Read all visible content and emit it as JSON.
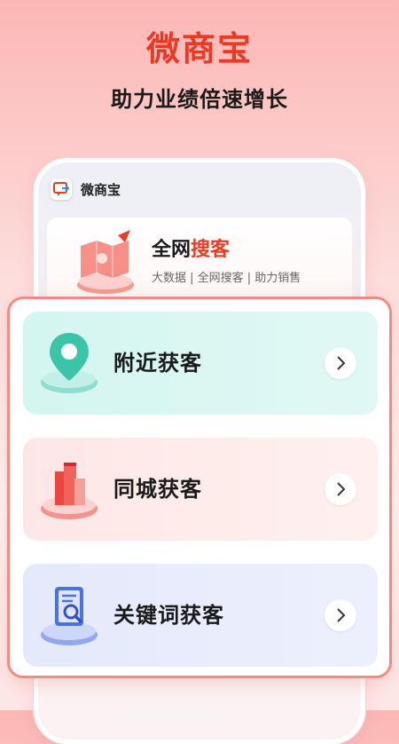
{
  "header": {
    "app_title": "微商宝",
    "slogan": "助力业绩倍速增长"
  },
  "mockup": {
    "app_name": "微商宝",
    "banner": {
      "title_prefix": "全网",
      "title_highlight": "搜客",
      "subtitle": "大数据 | 全网搜客 | 助力销售"
    }
  },
  "options": [
    {
      "label": "附近获客",
      "icon": "location-pin-icon"
    },
    {
      "label": "同城获客",
      "icon": "city-building-icon"
    },
    {
      "label": "关键词获客",
      "icon": "keyword-search-icon"
    }
  ],
  "colors": {
    "brand_red": "#ea3a26",
    "panel_border": "#f58a84",
    "teal": "#3cc4a9",
    "coral": "#f0625a",
    "blue": "#4a72e0"
  }
}
